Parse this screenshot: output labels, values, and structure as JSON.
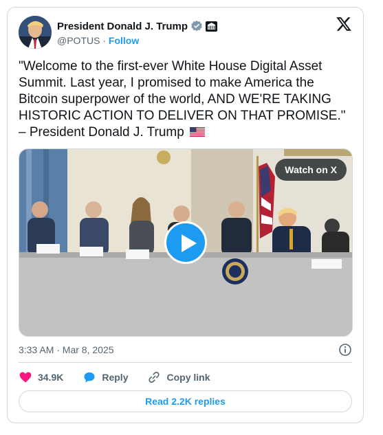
{
  "author": {
    "name": "President Donald J. Trump",
    "handle": "@POTUS",
    "separator": "·",
    "follow_label": "Follow"
  },
  "tweet": {
    "text": "\"Welcome to the first-ever White House Digital Asset Summit. Last year, I promised to make America the Bitcoin superpower of the world, AND WE'RE TAKING HISTORIC ACTION TO DELIVER ON THAT PROMISE.\" – President Donald J. Trump"
  },
  "media": {
    "watch_label": "Watch on X"
  },
  "meta": {
    "timestamp": "3:33 AM · Mar 8, 2025"
  },
  "actions": {
    "like_count": "34.9K",
    "reply_label": "Reply",
    "copy_label": "Copy link"
  },
  "footer": {
    "read_replies_label": "Read 2.2K replies"
  },
  "colors": {
    "accent": "#1d9bf0",
    "like": "#f91880",
    "text": "#0f1419",
    "muted": "#536471",
    "border": "#cfd9de"
  }
}
